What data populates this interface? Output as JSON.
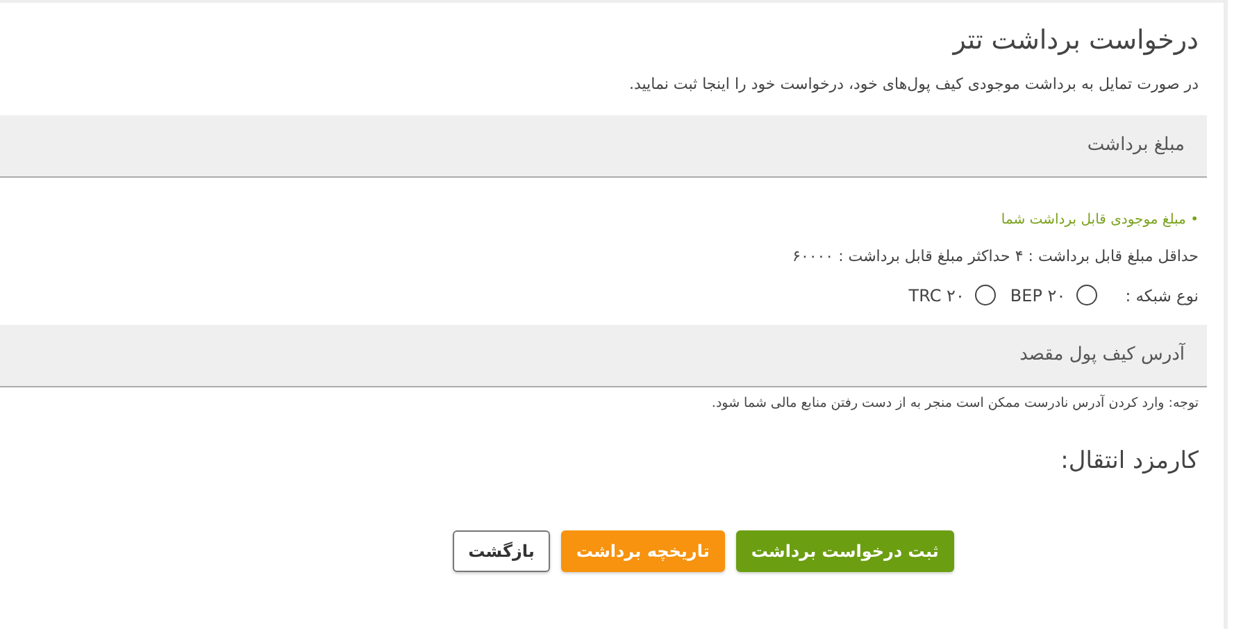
{
  "title": "درخواست برداشت تتر",
  "intro": "در صورت تمایل به برداشت موجودی کیف پول‌های خود، درخواست خود را اینجا ثبت نمایید.",
  "amount_field": {
    "placeholder": "مبلغ برداشت"
  },
  "balance_hint": "• مبلغ موجودی قابل برداشت شما",
  "limits": "حداقل مبلغ قابل برداشت : ۴ حداکثر مبلغ قابل برداشت : ۶۰۰۰۰",
  "network": {
    "label": "نوع شبکه :",
    "options": [
      {
        "label": "BEP ۲۰",
        "selected": false
      },
      {
        "label": "TRC ۲۰",
        "selected": false
      }
    ]
  },
  "address_field": {
    "placeholder": "آدرس کیف پول مقصد"
  },
  "warning": "توجه: وارد کردن آدرس نادرست ممکن است منجر به از دست رفتن منابع مالی شما شود.",
  "fee_label": "کارمزد انتقال:",
  "buttons": [
    {
      "label": "ثبت درخواست برداشت",
      "kind": "primary"
    },
    {
      "label": "تاریخچه برداشت",
      "kind": "secondary"
    },
    {
      "label": "بازگشت",
      "kind": "outline"
    }
  ]
}
